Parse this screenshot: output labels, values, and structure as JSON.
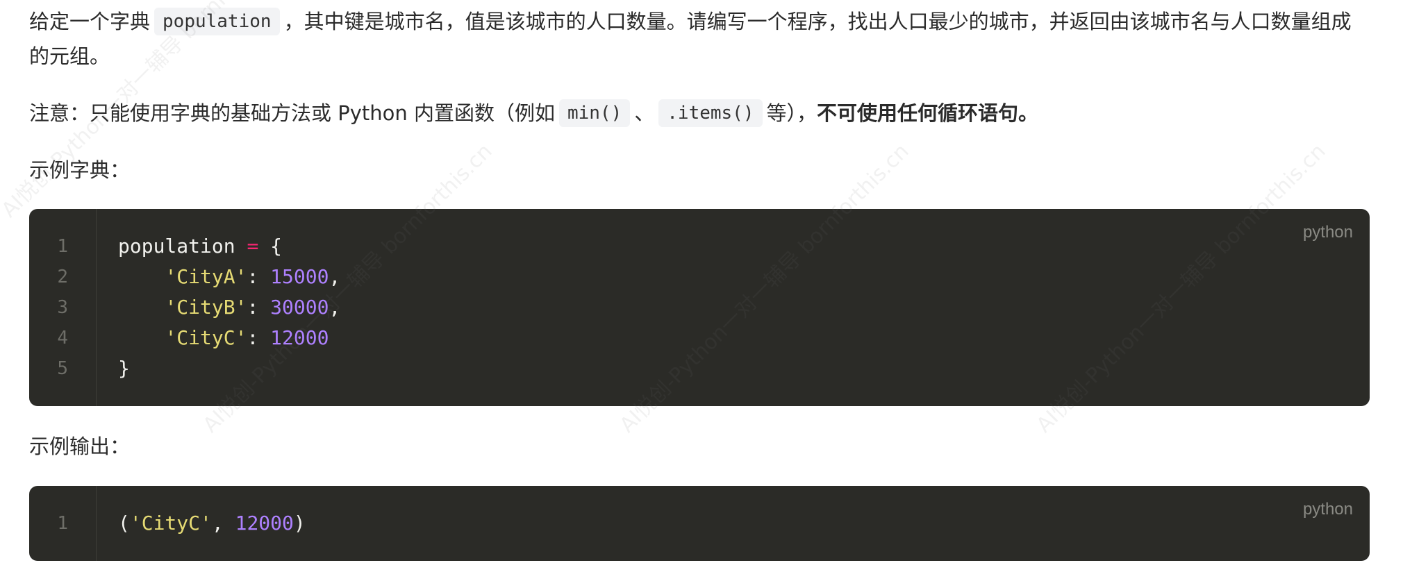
{
  "paragraph1": {
    "text_before": "给定一个字典",
    "code": "population",
    "text_after": "，其中键是城市名，值是该城市的人口数量。请编写一个程序，找出人口最少的城市，并返回由该城市名与人口数量组成的元组。"
  },
  "paragraph2": {
    "text_before": "注意：只能使用字典的基础方法或 Python 内置函数（例如",
    "code1": "min()",
    "separator": "、",
    "code2": ".items()",
    "text_mid": "等），",
    "bold_text": "不可使用任何循环语句。"
  },
  "example_dict_heading": "示例字典：",
  "example_output_heading": "示例输出：",
  "code_block_1": {
    "language": "python",
    "lines": [
      {
        "num": "1",
        "var": "population",
        "op": "=",
        "rest": "{"
      },
      {
        "num": "2",
        "key": "'CityA'",
        "colon": ":",
        "value": "15000",
        "end": ","
      },
      {
        "num": "3",
        "key": "'CityB'",
        "colon": ":",
        "value": "30000",
        "end": ","
      },
      {
        "num": "4",
        "key": "'CityC'",
        "colon": ":",
        "value": "12000",
        "end": ""
      },
      {
        "num": "5",
        "text": "}"
      }
    ]
  },
  "code_block_2": {
    "language": "python",
    "lines": [
      {
        "num": "1",
        "open": "(",
        "str": "'CityC'",
        "sep": ", ",
        "value": "12000",
        "close": ")"
      }
    ]
  },
  "watermark": {
    "text": "AI悦创-Python一对一辅导 bornforthis.cn"
  }
}
